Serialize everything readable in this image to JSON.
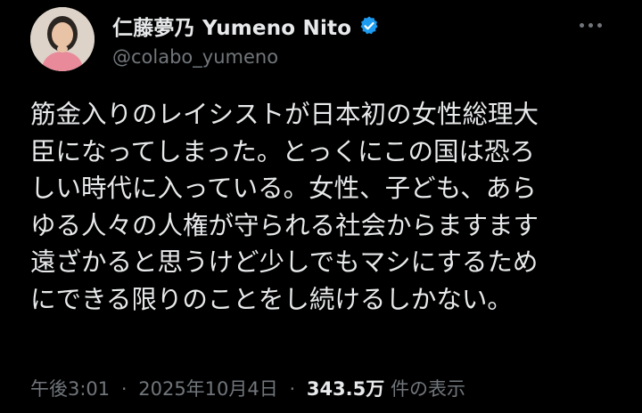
{
  "post": {
    "author": {
      "display_name": "仁藤夢乃 Yumeno Nito",
      "handle": "@colabo_yumeno",
      "verified_icon": "verified-badge-icon",
      "avatar": "avatar"
    },
    "more_icon": "more-options-icon",
    "text_lines": [
      "筋金入りのレイシストが日本初の女性総理大",
      "臣になってしまった。とっくにこの国は恐ろ",
      "しい時代に入っている。女性、子ども、あら",
      "ゆる人々の人権が守られる社会からますます",
      "遠ざかると思うけど少しでもマシにするため",
      "にできる限りのことをし続けるしかない。"
    ],
    "time": "午後3:01",
    "separator": "·",
    "date": "2025年10月4日",
    "views_count": "343.5万",
    "views_label": "件の表示"
  },
  "colors": {
    "background": "#000000",
    "text": "#e7e9ea",
    "muted": "#71767b",
    "verified": "#1d9bf0"
  }
}
